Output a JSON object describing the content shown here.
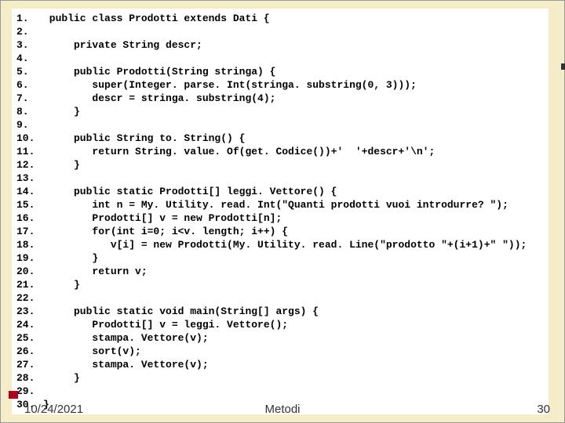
{
  "lines": [
    {
      "n": "1.",
      "t": " public class Prodotti extends Dati {"
    },
    {
      "n": "2.",
      "t": ""
    },
    {
      "n": "3.",
      "t": "     private String descr;"
    },
    {
      "n": "4.",
      "t": ""
    },
    {
      "n": "5.",
      "t": "     public Prodotti(String stringa) {"
    },
    {
      "n": "6.",
      "t": "        super(Integer. parse. Int(stringa. substring(0, 3)));"
    },
    {
      "n": "7.",
      "t": "        descr = stringa. substring(4);"
    },
    {
      "n": "8.",
      "t": "     }"
    },
    {
      "n": "9.",
      "t": ""
    },
    {
      "n": "10.",
      "t": "     public String to. String() {"
    },
    {
      "n": "11.",
      "t": "        return String. value. Of(get. Codice())+'  '+descr+'\\n';"
    },
    {
      "n": "12.",
      "t": "     }"
    },
    {
      "n": "13.",
      "t": ""
    },
    {
      "n": "14.",
      "t": "     public static Prodotti[] leggi. Vettore() {"
    },
    {
      "n": "15.",
      "t": "        int n = My. Utility. read. Int(\"Quanti prodotti vuoi introdurre? \");"
    },
    {
      "n": "16.",
      "t": "        Prodotti[] v = new Prodotti[n];"
    },
    {
      "n": "17.",
      "t": "        for(int i=0; i<v. length; i++) {"
    },
    {
      "n": "18.",
      "t": "           v[i] = new Prodotti(My. Utility. read. Line(\"prodotto \"+(i+1)+\" \"));"
    },
    {
      "n": "19.",
      "t": "        }"
    },
    {
      "n": "20.",
      "t": "        return v;"
    },
    {
      "n": "21.",
      "t": "     }"
    },
    {
      "n": "22.",
      "t": ""
    },
    {
      "n": "23.",
      "t": "     public static void main(String[] args) {"
    },
    {
      "n": "24.",
      "t": "        Prodotti[] v = leggi. Vettore();"
    },
    {
      "n": "25.",
      "t": "        stampa. Vettore(v);"
    },
    {
      "n": "26.",
      "t": "        sort(v);"
    },
    {
      "n": "27.",
      "t": "        stampa. Vettore(v);"
    },
    {
      "n": "28.",
      "t": "     }"
    },
    {
      "n": "29.",
      "t": ""
    },
    {
      "n": "30.",
      "t": "}"
    }
  ],
  "footer": {
    "date": "10/24/2021",
    "title": "Metodi",
    "page": "30"
  }
}
